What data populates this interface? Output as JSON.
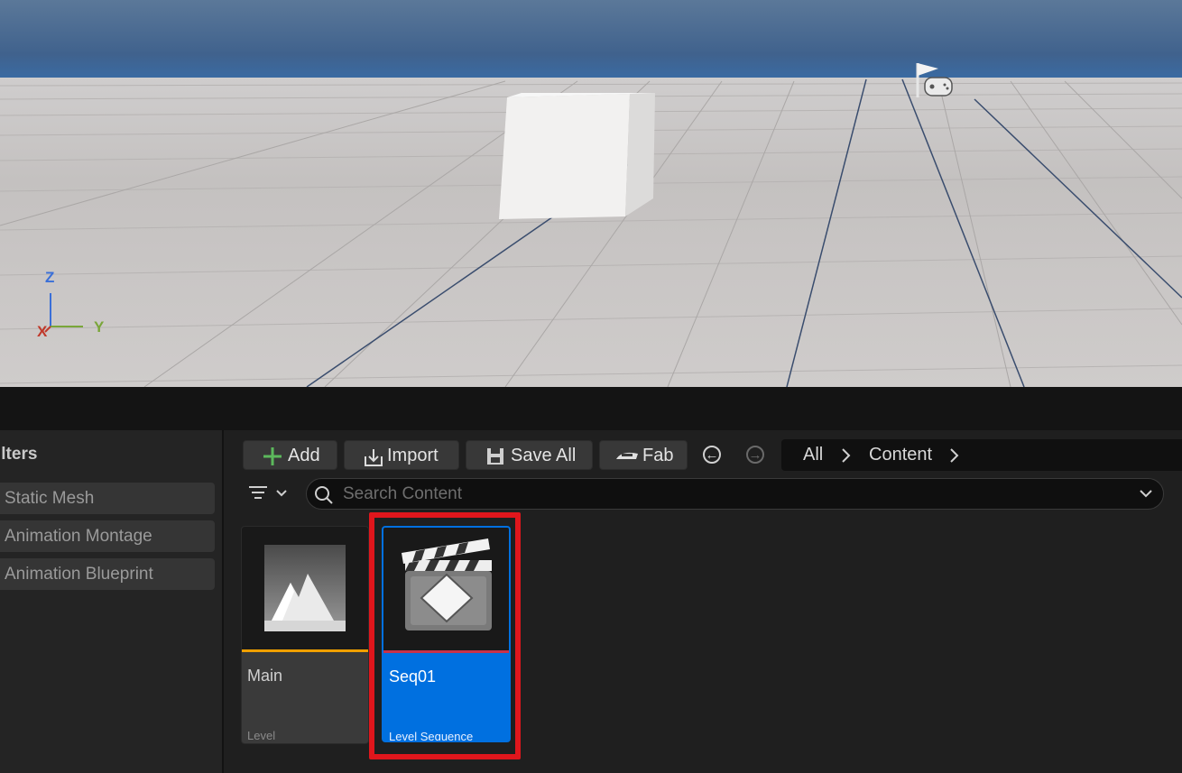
{
  "viewport": {
    "axis": {
      "z": "Z",
      "x": "X",
      "y": "Y"
    },
    "icons": [
      "player-start-icon"
    ]
  },
  "filters": {
    "title": "ilters",
    "items": [
      {
        "label": "Static Mesh"
      },
      {
        "label": "Animation Montage"
      },
      {
        "label": "Animation Blueprint"
      }
    ]
  },
  "toolbar": {
    "add_label": "Add",
    "import_label": "Import",
    "save_all_label": "Save All",
    "fab_label": "Fab",
    "breadcrumb": [
      "All",
      "Content"
    ]
  },
  "search": {
    "placeholder": "Search Content"
  },
  "assets": [
    {
      "name": "Main",
      "type": "Level",
      "accent": "#f0a000",
      "selected": false
    },
    {
      "name": "Seq01",
      "type": "Level Sequence",
      "accent": "#c8324a",
      "selected": true
    }
  ],
  "colors": {
    "selection": "#0070e0",
    "highlight_box": "#e0161c",
    "axis_x": "#c0392b",
    "axis_y": "#7aa63a",
    "axis_z": "#3a6fd8"
  }
}
